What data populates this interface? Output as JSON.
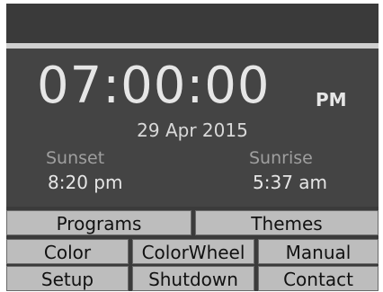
{
  "clock": {
    "time": "07:00:00",
    "ampm": "PM",
    "date": "29 Apr 2015"
  },
  "sun": {
    "sunset_label": "Sunset",
    "sunset_time": "8:20 pm",
    "sunrise_label": "Sunrise",
    "sunrise_time": "5:37 am"
  },
  "buttons": {
    "programs": "Programs",
    "themes": "Themes",
    "color": "Color",
    "colorwheel": "ColorWheel",
    "manual": "Manual",
    "setup": "Setup",
    "shutdown": "Shutdown",
    "contact": "Contact"
  },
  "colors": {
    "background": "#444444",
    "button": "#bdbdbd",
    "text": "#e6e6e6"
  }
}
